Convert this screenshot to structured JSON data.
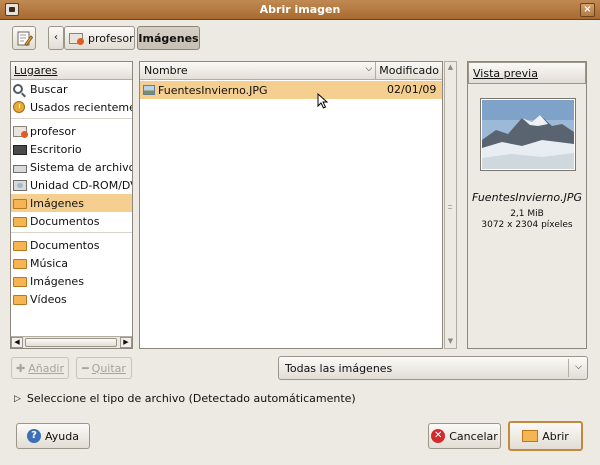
{
  "window": {
    "title": "Abrir imagen",
    "close_glyph": "×",
    "app_icon": "camera-icon"
  },
  "toolbar": {
    "edit_icon": "edit-location-icon",
    "back_glyph": "‹"
  },
  "breadcrumb": [
    {
      "label": "profesor",
      "icon": "home-folder-icon"
    },
    {
      "label": "Imágenes"
    }
  ],
  "places": {
    "header": "Lugares",
    "system": [
      {
        "label": "Buscar",
        "icon": "search-icon"
      },
      {
        "label": "Usados recientemente",
        "icon": "recent-icon"
      },
      {
        "label": "profesor",
        "icon": "home-icon"
      },
      {
        "label": "Escritorio",
        "icon": "desktop-icon"
      },
      {
        "label": "Sistema de archivos",
        "icon": "drive-icon"
      },
      {
        "label": "Unidad CD-ROM/DVD",
        "icon": "cdrom-icon"
      },
      {
        "label": "Imágenes",
        "icon": "folder-icon",
        "selected": true
      },
      {
        "label": "Documentos",
        "icon": "folder-icon"
      }
    ],
    "bookmarks": [
      {
        "label": "Documentos",
        "icon": "folder-icon"
      },
      {
        "label": "Música",
        "icon": "folder-icon"
      },
      {
        "label": "Imágenes",
        "icon": "folder-icon"
      },
      {
        "label": "Vídeos",
        "icon": "folder-icon"
      }
    ]
  },
  "files": {
    "columns": {
      "name": "Nombre",
      "modified": "Modificado"
    },
    "rows": [
      {
        "name": "FuentesInvierno.JPG",
        "modified": "02/01/09",
        "selected": true
      }
    ]
  },
  "preview": {
    "label": "Vista previa",
    "filename": "FuentesInvierno.JPG",
    "size": "2,1 MiB",
    "dimensions": "3072 x 2304 píxeles"
  },
  "actions": {
    "add": "Añadir",
    "remove": "Quitar"
  },
  "filter": {
    "selected": "Todas las imágenes"
  },
  "expander": {
    "label": "Seleccione el tipo de archivo (Detectado automáticamente)"
  },
  "buttons": {
    "help": "Ayuda",
    "cancel": "Cancelar",
    "open": "Abrir"
  },
  "colors": {
    "titlebar": "#b07538",
    "selection": "#f5cf8f",
    "accent": "#c3893f"
  }
}
